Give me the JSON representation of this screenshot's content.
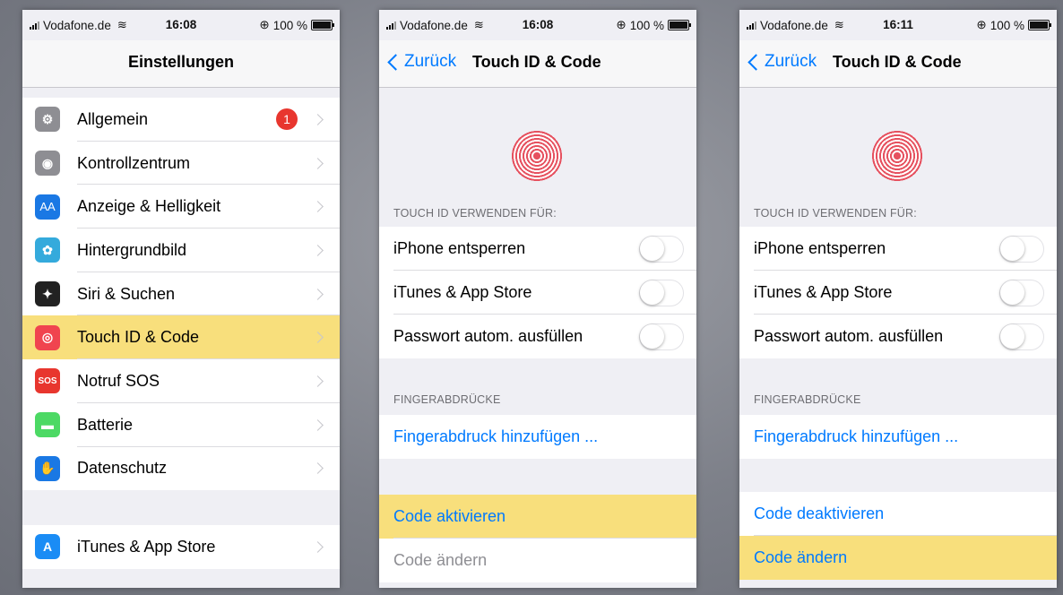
{
  "status": {
    "carrier": "Vodafone.de",
    "battery": "100 %",
    "time1": "16:08",
    "time2": "16:08",
    "time3": "16:11"
  },
  "settings": {
    "title": "Einstellungen",
    "items": [
      {
        "label": "Allgemein",
        "icon": "gear-icon",
        "color": "#8e8e93",
        "badge": "1"
      },
      {
        "label": "Kontrollzentrum",
        "icon": "toggles-icon",
        "color": "#8e8e93"
      },
      {
        "label": "Anzeige & Helligkeit",
        "icon": "text-size-icon",
        "color": "#1a78e4"
      },
      {
        "label": "Hintergrundbild",
        "icon": "flower-icon",
        "color": "#34aadc"
      },
      {
        "label": "Siri & Suchen",
        "icon": "siri-icon",
        "color": "#222222"
      },
      {
        "label": "Touch ID & Code",
        "icon": "fingerprint-icon",
        "color": "#f0444f"
      },
      {
        "label": "Notruf SOS",
        "icon": "sos-icon",
        "color": "#e8362e"
      },
      {
        "label": "Batterie",
        "icon": "battery-icon",
        "color": "#4cd964"
      },
      {
        "label": "Datenschutz",
        "icon": "hand-icon",
        "color": "#1a78e4"
      }
    ],
    "store_item": {
      "label": "iTunes & App Store",
      "icon": "app-store-icon",
      "color": "#1a8cf5"
    }
  },
  "touchid": {
    "back": "Zurück",
    "title": "Touch ID & Code",
    "use_header": "TOUCH ID VERWENDEN FÜR:",
    "toggles": [
      "iPhone entsperren",
      "iTunes & App Store",
      "Passwort autom. ausfüllen"
    ],
    "fingerprints_header": "FINGERABDRÜCKE",
    "add_fingerprint": "Fingerabdruck hinzufügen ...",
    "code_activate": "Code aktivieren",
    "code_change": "Code ändern",
    "code_deactivate": "Code deaktivieren"
  },
  "colors": {
    "highlight": "#f8df7c",
    "accent": "#007aff"
  }
}
